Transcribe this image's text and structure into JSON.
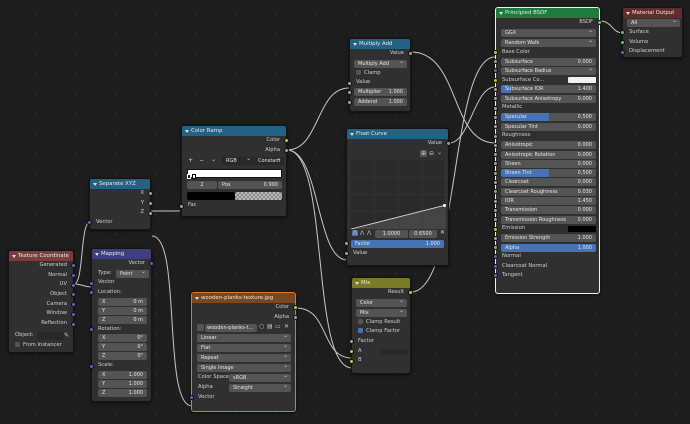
{
  "colors": {
    "wire": "#c0c0c0",
    "selected": "#e07a1f",
    "socket_float": "#a1a1a1",
    "socket_color": "#c7c729",
    "socket_vector": "#6363c7",
    "socket_shader": "#63c763"
  },
  "texcoord": {
    "title": "Texture Coordinate",
    "outputs": [
      "Generated",
      "Normal",
      "UV",
      "Object",
      "Camera",
      "Window",
      "Reflection"
    ],
    "object_label": "Object:",
    "instancer_label": "From Instancer"
  },
  "separate": {
    "title": "Separate XYZ",
    "outputs": [
      "X",
      "Y",
      "Z"
    ],
    "input": "Vector"
  },
  "mapping": {
    "title": "Mapping",
    "output": "Vector",
    "type_label": "Type:",
    "type_value": "Point",
    "input_vector": "Vector",
    "location_label": "Location:",
    "location": [
      {
        "axis": "X",
        "value": "0 m"
      },
      {
        "axis": "Y",
        "value": "0 m"
      },
      {
        "axis": "Z",
        "value": "0 m"
      }
    ],
    "rotation_label": "Rotation:",
    "rotation": [
      {
        "axis": "X",
        "value": "0°"
      },
      {
        "axis": "Y",
        "value": "0°"
      },
      {
        "axis": "Z",
        "value": "0°"
      }
    ],
    "scale_label": "Scale:",
    "scale": [
      {
        "axis": "X",
        "value": "1.000"
      },
      {
        "axis": "Y",
        "value": "1.000"
      },
      {
        "axis": "Z",
        "value": "1.000"
      }
    ]
  },
  "colorramp": {
    "title": "Color Ramp",
    "outputs": [
      "Color",
      "Alpha"
    ],
    "mode": "RGB",
    "interp": "Constant",
    "add": "+",
    "remove": "−",
    "menu": "⌄",
    "index": "2",
    "pos_label": "Pos",
    "pos_value": "0.900",
    "input": "Fac"
  },
  "imagetex": {
    "title": "wooden-planks-texture.jpg",
    "outputs": [
      "Color",
      "Alpha"
    ],
    "image_name": "wooden-planks-t...",
    "interpolation": "Linear",
    "projection": "Flat",
    "extension": "Repeat",
    "source": "Single Image",
    "colorspace_label": "Color Space",
    "colorspace_value": "sRGB",
    "alpha_label": "Alpha",
    "alpha_value": "Straight",
    "input": "Vector"
  },
  "multiplyadd": {
    "title": "Multiply Add",
    "output": "Value",
    "operation": "Multiply Add",
    "clamp": "Clamp",
    "input_value": "Value",
    "multiplier_label": "Multiplier",
    "multiplier_value": "1.000",
    "addend_label": "Addend",
    "addend_value": "1.000"
  },
  "floatcurve": {
    "title": "Float Curve",
    "output": "Value",
    "point_x": "1.0000",
    "point_y": "0.6500",
    "factor_label": "Factor",
    "factor_value": "1.000",
    "factor_fraction": 1.0,
    "input": "Value"
  },
  "mix": {
    "title": "Mix",
    "output": "Result",
    "data_type": "Color",
    "blend": "Mix",
    "clamp_result": "Clamp Result",
    "clamp_factor": "Clamp Factor",
    "clamp_factor_on": true,
    "factor_label": "Factor",
    "a_label": "A",
    "b_label": "B"
  },
  "bsdf": {
    "title": "Principled BSDF",
    "output": "BSDF",
    "distribution": "GGX",
    "subsurface_method": "Random Walk",
    "rows": [
      {
        "label": "Base Color",
        "kind": "socket",
        "socket": "y"
      },
      {
        "label": "Subsurface",
        "value": "0.000",
        "kind": "field",
        "socket": "g"
      },
      {
        "label": "Subsurface Radius",
        "kind": "dropdown",
        "socket": "p"
      },
      {
        "label": "Subsurface Co...",
        "kind": "colorfield",
        "socket": "y"
      },
      {
        "label": "Subsurface IOR",
        "value": "1.400",
        "kind": "field",
        "socket": "g",
        "fill": 0.1
      },
      {
        "label": "Subsurface Anisotropy",
        "value": "0.000",
        "kind": "field",
        "socket": "g"
      },
      {
        "label": "Metallic",
        "kind": "socket",
        "socket": "g"
      },
      {
        "label": "Specular",
        "value": "0.500",
        "kind": "field",
        "socket": "g",
        "fill": 0.5
      },
      {
        "label": "Specular Tint",
        "value": "0.000",
        "kind": "field",
        "socket": "g"
      },
      {
        "label": "Roughness",
        "kind": "socket",
        "socket": "g"
      },
      {
        "label": "Anisotropic",
        "value": "0.000",
        "kind": "field",
        "socket": "g"
      },
      {
        "label": "Anisotropic Rotation",
        "value": "0.000",
        "kind": "field",
        "socket": "g"
      },
      {
        "label": "Sheen",
        "value": "0.000",
        "kind": "field",
        "socket": "g"
      },
      {
        "label": "Sheen Tint",
        "value": "0.500",
        "kind": "field",
        "socket": "g",
        "fill": 0.5
      },
      {
        "label": "Clearcoat",
        "value": "0.000",
        "kind": "field",
        "socket": "g"
      },
      {
        "label": "Clearcoat Roughness",
        "value": "0.030",
        "kind": "field",
        "socket": "g"
      },
      {
        "label": "IOR",
        "value": "1.450",
        "kind": "field",
        "socket": "g"
      },
      {
        "label": "Transmission",
        "value": "0.000",
        "kind": "field",
        "socket": "g"
      },
      {
        "label": "Transmission Roughness",
        "value": "0.000",
        "kind": "field",
        "socket": "g"
      },
      {
        "label": "Emission",
        "kind": "colorfield-dark",
        "socket": "y"
      },
      {
        "label": "Emission Strength",
        "value": "1.000",
        "kind": "field",
        "socket": "g"
      },
      {
        "label": "Alpha",
        "value": "1.000",
        "kind": "field",
        "socket": "g",
        "fill": 1.0
      },
      {
        "label": "Normal",
        "kind": "socket",
        "socket": "p"
      },
      {
        "label": "Clearcoat Normal",
        "kind": "socket",
        "socket": "p"
      },
      {
        "label": "Tangent",
        "kind": "socket",
        "socket": "p"
      }
    ]
  },
  "output": {
    "title": "Material Output",
    "target": "All",
    "inputs": [
      "Surface",
      "Volume",
      "Displacement"
    ]
  }
}
